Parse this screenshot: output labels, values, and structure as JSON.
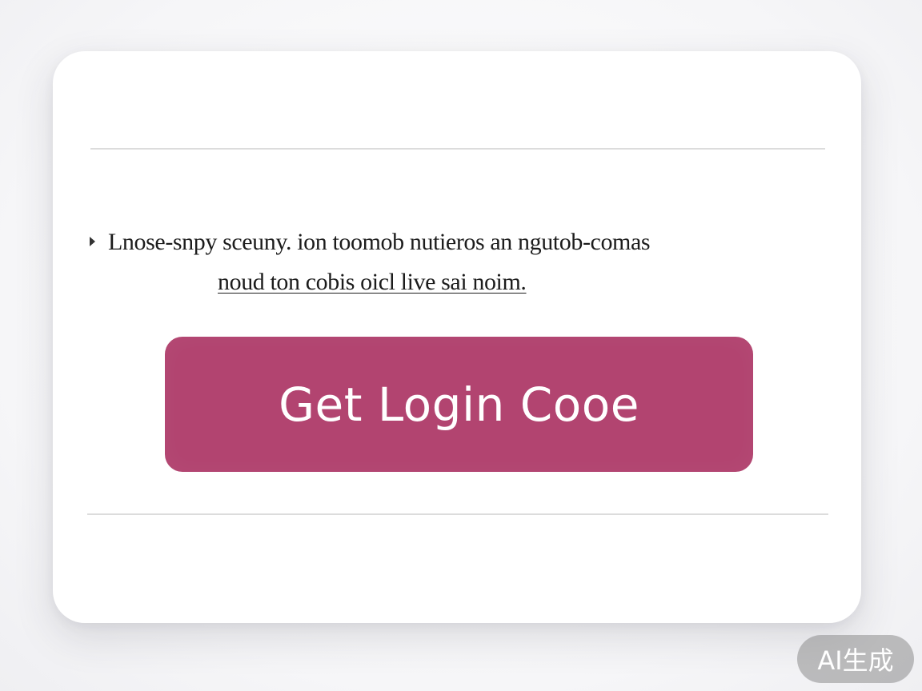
{
  "card": {
    "message": {
      "line1": "Lnose-snpy sceuny. ion toomob nutieros an ngutob-comas",
      "link": "noud ton cobis oicl live sai noim."
    },
    "cta_button_label": "Get Login Cooe"
  },
  "watermark": "AI生成"
}
